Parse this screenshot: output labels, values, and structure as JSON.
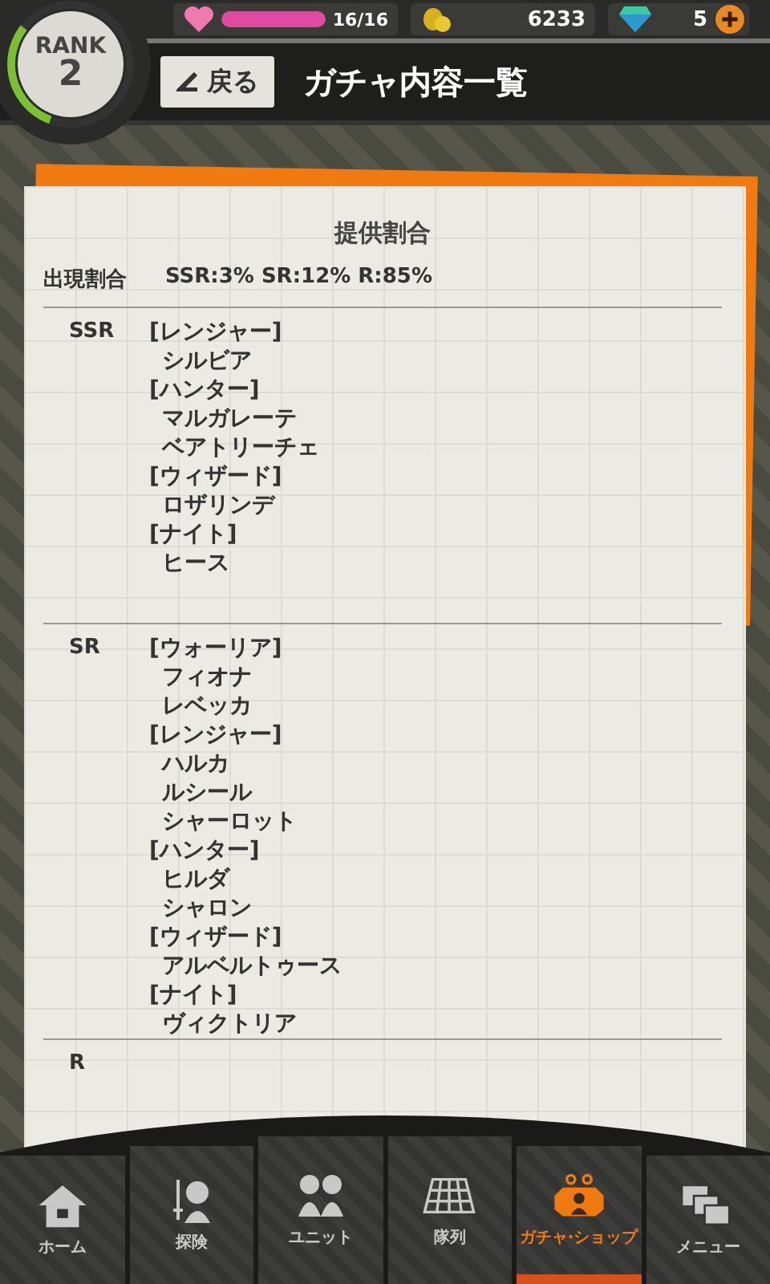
{
  "status_bar": {
    "rank": {
      "label": "RANK",
      "value": "2",
      "level": 0.3
    },
    "stamina": {
      "value": "16/16",
      "level": 1
    },
    "coins": "6233",
    "gems": "5"
  },
  "title_bar": {
    "back_button": "戻る",
    "title": "ガチャ内容一覧"
  },
  "card": {
    "heading": "提供割合",
    "rate_label": "出現割合",
    "rate_value": "SSR:3% SR:12% R:85%",
    "sections": [
      {
        "rarity": "SSR",
        "groups": [
          {
            "class": "[レンジャー]",
            "names": [
              "シルビア"
            ]
          },
          {
            "class": "[ハンター]",
            "names": [
              "マルガレーテ",
              "ベアトリーチェ"
            ]
          },
          {
            "class": "[ウィザード]",
            "names": [
              "ロザリンデ"
            ]
          },
          {
            "class": "[ナイト]",
            "names": [
              "ヒース"
            ]
          }
        ]
      },
      {
        "rarity": "SR",
        "groups": [
          {
            "class": "[ウォーリア]",
            "names": [
              "フィオナ",
              "レベッカ"
            ]
          },
          {
            "class": "[レンジャー]",
            "names": [
              "ハルカ",
              "ルシール",
              "シャーロット"
            ]
          },
          {
            "class": "[ハンター]",
            "names": [
              "ヒルダ",
              "シャロン"
            ]
          },
          {
            "class": "[ウィザード]",
            "names": [
              "アルベルトゥース"
            ]
          },
          {
            "class": "[ナイト]",
            "names": [
              "ヴィクトリア"
            ]
          }
        ]
      },
      {
        "rarity": "R"
      }
    ]
  },
  "nav": [
    {
      "label": "ホーム",
      "selected": false
    },
    {
      "label": "探険",
      "selected": false
    },
    {
      "label": "ユニット",
      "selected": false
    },
    {
      "label": "隊列",
      "selected": false
    },
    {
      "label": "ガチャ·ショップ",
      "selected": true
    },
    {
      "label": "メニュー",
      "selected": false
    }
  ]
}
